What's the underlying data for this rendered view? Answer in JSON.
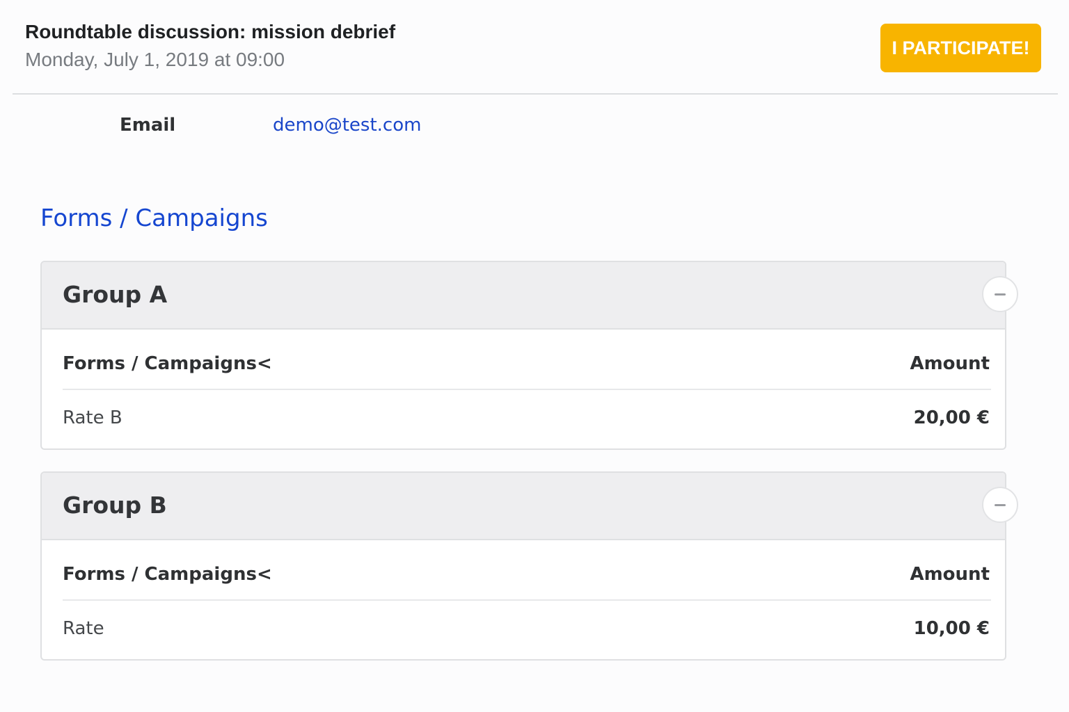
{
  "event": {
    "title": "Roundtable discussion: mission debrief",
    "date": "Monday, July 1, 2019 at 09:00",
    "participate_label": "I PARTICIPATE!"
  },
  "contact": {
    "email_label": "Email",
    "email_value": "demo@test.com"
  },
  "forms_section": {
    "title": "Forms / Campaigns",
    "groups": [
      {
        "name": "Group A",
        "columns": {
          "name": "Forms / Campaigns<",
          "amount": "Amount"
        },
        "rows": [
          {
            "name": "Rate B",
            "amount": "20,00 €"
          }
        ]
      },
      {
        "name": "Group B",
        "columns": {
          "name": "Forms / Campaigns<",
          "amount": "Amount"
        },
        "rows": [
          {
            "name": "Rate",
            "amount": "10,00 €"
          }
        ]
      }
    ]
  },
  "colors": {
    "accent": "#f8b400",
    "link": "#1546d0"
  },
  "icons": {
    "collapse": "minus-icon"
  }
}
